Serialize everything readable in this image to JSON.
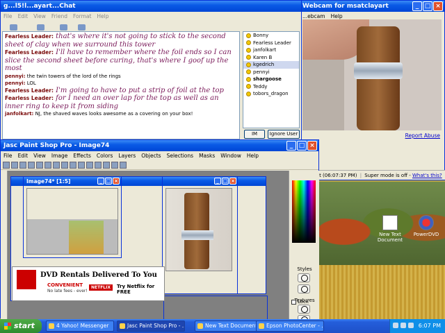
{
  "desktop": {
    "icons": [
      {
        "label": "New Text Document",
        "icon": "text-document-icon"
      },
      {
        "label": "PowerDVD",
        "icon": "dvd-player-icon"
      }
    ]
  },
  "chat": {
    "title": "g...l5!l...ayart...Chat",
    "menu": [
      "File",
      "Edit",
      "View",
      "Friend",
      "Format",
      "Help"
    ],
    "toolbar": [
      "Send File",
      "Webcam",
      "Voice",
      "Chat"
    ],
    "messages": [
      {
        "who": "Fearless Leader:",
        "text": " that's where it's not going to stick to the second sheet of clay when we surround this tower",
        "fancy": true
      },
      {
        "who": "Fearless Leader:",
        "text": " I'll have to remember where the foil ends so I can slice the second sheet before curing, that's where I goof up the most",
        "fancy": true
      },
      {
        "who": "pennyi:",
        "text": " the twin towers of the lord of the rings",
        "fancy": false
      },
      {
        "who": "pennyi:",
        "text": " LOL",
        "fancy": false
      },
      {
        "who": "Fearless Leader:",
        "text": " I'm going to have to put a strip of foil at the top",
        "fancy": true
      },
      {
        "who": "Fearless Leader:",
        "text": " for I need an over lap for the top as well as an inner ring to keep it from siding",
        "fancy": true
      },
      {
        "who": "janfolkart:",
        "text": " NJ, the shaved waves looks awesome as a covering on your box!",
        "fancy": false
      }
    ],
    "buddies": [
      {
        "name": "Bonny",
        "selected": false,
        "bold": false
      },
      {
        "name": "Fearless Leader",
        "selected": false,
        "bold": false
      },
      {
        "name": "janfolkart",
        "selected": false,
        "bold": false
      },
      {
        "name": "Karen B",
        "selected": false,
        "bold": false
      },
      {
        "name": "kgedrich",
        "selected": true,
        "bold": false
      },
      {
        "name": "pennyi",
        "selected": false,
        "bold": false
      },
      {
        "name": "shargoose",
        "selected": false,
        "bold": true
      },
      {
        "name": "Teddy",
        "selected": false,
        "bold": false
      },
      {
        "name": "tobors_dragon",
        "selected": false,
        "bold": false
      }
    ],
    "im_label": "IM",
    "ignore_label": "Ignore User"
  },
  "webcam": {
    "title": "Webcam for msatclayart",
    "menu": [
      "...ebcam",
      "Help"
    ],
    "report_abuse": "Report Abuse",
    "status_time": "...ved at (06:07:37 PM)",
    "super_mode": "Super mode is off -",
    "whats_this": "What's this?"
  },
  "psp": {
    "title": "Jasc Paint Shop Pro - Image74",
    "menu": [
      "File",
      "Edit",
      "View",
      "Image",
      "Effects",
      "Colors",
      "Layers",
      "Objects",
      "Selections",
      "Masks",
      "Window",
      "Help"
    ],
    "subwin_title": "Image74* [1:5]",
    "ad": {
      "title": "DVD Rentals Delivered To You",
      "sub": "CONVENIENT",
      "sub2": "No late fees - ever!",
      "brand": "NETFLIX",
      "try": "Try Netflix for FREE"
    },
    "panel": {
      "styles": "Styles",
      "textures": "Textures",
      "lock": "Lock"
    }
  },
  "taskbar": {
    "start": "start",
    "tasks": [
      {
        "label": "4 Yahoo! Messenger",
        "active": false
      },
      {
        "label": "Jasc Paint Shop Pro - ...",
        "active": true
      },
      {
        "label": "New Text Document - ...",
        "active": false
      },
      {
        "label": "Epson PhotoCenter - ...",
        "active": false
      }
    ],
    "clock": "6:07 PM"
  },
  "colors": {
    "xp_blue": "#0046d5",
    "chat_name": "#7a0a0a",
    "chat_fancy": "#7a1a5a",
    "link": "#0000cc"
  }
}
